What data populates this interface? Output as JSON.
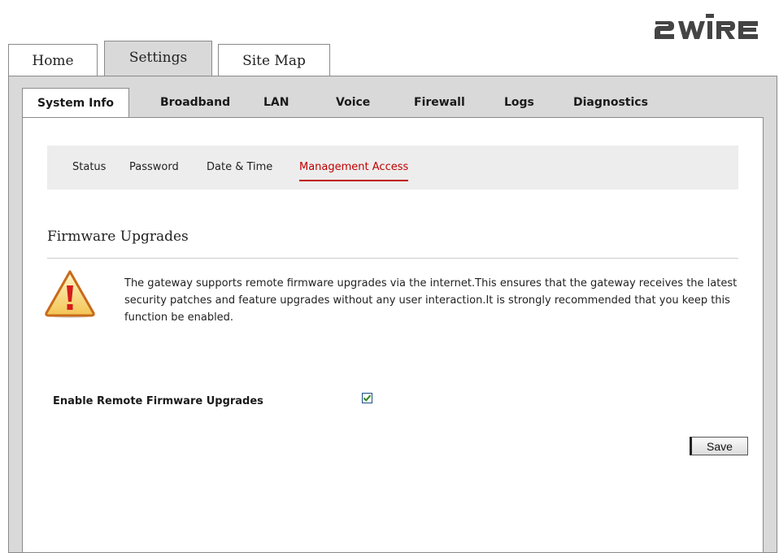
{
  "brand": {
    "logo_text": "2WIRE"
  },
  "top_tabs": [
    {
      "label": "Home"
    },
    {
      "label": "Settings",
      "active": true
    },
    {
      "label": "Site Map"
    }
  ],
  "sub_tabs": [
    {
      "label": "System Info",
      "active": true
    },
    {
      "label": "Broadband"
    },
    {
      "label": "LAN"
    },
    {
      "label": "Voice"
    },
    {
      "label": "Firewall"
    },
    {
      "label": "Logs"
    },
    {
      "label": "Diagnostics"
    }
  ],
  "section_nav": [
    {
      "label": "Status"
    },
    {
      "label": "Password"
    },
    {
      "label": "Date & Time"
    },
    {
      "label": "Management Access",
      "active": true
    }
  ],
  "content": {
    "heading": "Firmware Upgrades",
    "warning_icon": "warning-triangle-icon",
    "warning_text": "The gateway supports remote firmware upgrades via the internet.This ensures that the gateway receives the latest security patches and feature upgrades without any user interaction.It is strongly recommended that you keep this function be enabled.",
    "enable_label": "Enable Remote Firmware Upgrades",
    "enable_checked": true,
    "save_label": "Save"
  },
  "colors": {
    "accent": "#c00000",
    "frame": "#d9d9d9",
    "check": "#2e8b1e"
  }
}
